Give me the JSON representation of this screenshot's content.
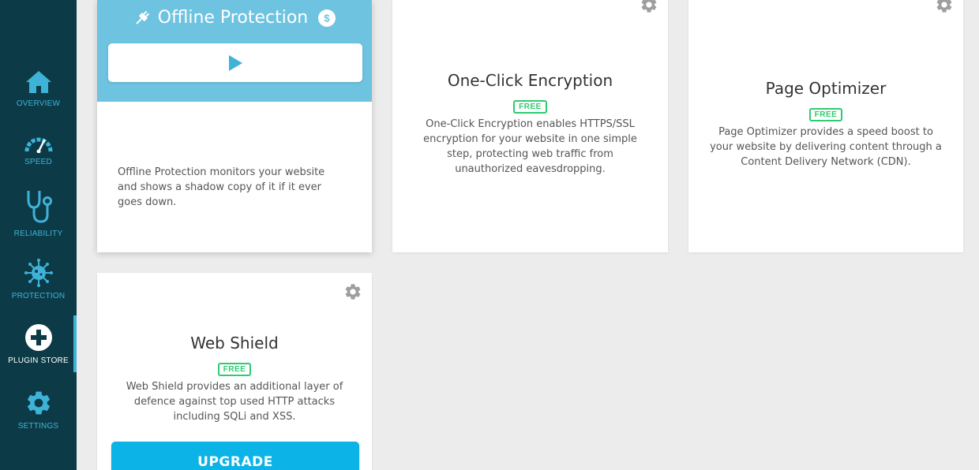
{
  "sidebar": {
    "items": [
      {
        "label": "OVERVIEW",
        "icon": "home-icon"
      },
      {
        "label": "SPEED",
        "icon": "speedometer-icon"
      },
      {
        "label": "RELIABILITY",
        "icon": "stethoscope-icon"
      },
      {
        "label": "PROTECTION",
        "icon": "virus-icon"
      },
      {
        "label": "PLUGIN STORE",
        "icon": "plus-circle-icon",
        "active": true
      },
      {
        "label": "SETTINGS",
        "icon": "gear-icon"
      }
    ]
  },
  "cards": {
    "offline": {
      "title": "Offline Protection",
      "badge_icon": "dollar-icon",
      "description": "Offline Protection monitors your website and shows a shadow copy of it if it ever goes down."
    },
    "encryption": {
      "title": "One-Click Encryption",
      "badge": "FREE",
      "description": "One-Click Encryption enables HTTPS/SSL encryption for your website in one simple step, protecting web traffic from unauthorized eavesdropping."
    },
    "optimizer": {
      "title": "Page Optimizer",
      "badge": "FREE",
      "description": "Page Optimizer provides a speed boost to your website by delivering content through a Content Delivery Network (CDN)."
    },
    "webshield": {
      "title": "Web Shield",
      "badge": "FREE",
      "description": "Web Shield provides an additional layer of defence against top used HTTP attacks including SQLi and XSS.",
      "button": "UPGRADE"
    }
  },
  "colors": {
    "sidebar_bg": "#0c3b47",
    "accent": "#3fb2d8",
    "free_green": "#2ecc71",
    "upgrade_blue": "#0cb3e6",
    "offline_header": "#6ec3e1"
  }
}
